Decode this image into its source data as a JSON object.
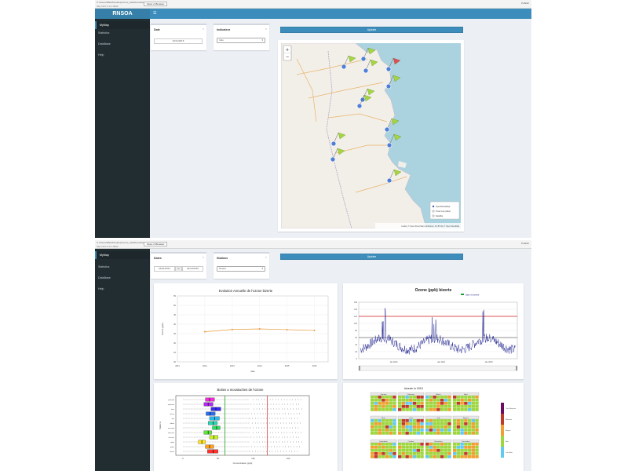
{
  "panel1": {
    "chrome": {
      "url": "C:/Users/WEG/Desktop/ozone_dashboard/app.R",
      "sub": "http://127.0.0.1:4092",
      "open_browser": "Open in Browser",
      "publish": "Publish"
    },
    "app_title": "RNSOA",
    "sidebar": [
      "MyMap",
      "Statistics",
      "DataBase",
      "Help"
    ],
    "date_label": "Date",
    "date_value": "22/11/2015",
    "indicator_label": "Indicateur",
    "indicator_value": "Indo",
    "update_label": "Update",
    "map": {
      "zoom_in": "+",
      "zoom_out": "−",
      "layers": [
        "OpenStreetMap",
        "Toner-Lite (b&w)",
        "Satellite"
      ],
      "attribution": "Leaflet | © Open Street Map contributors, CC-BY-SA, © Open StreetMap",
      "colors": {
        "sea": "#aad3df",
        "land": "#f2efe9",
        "flag_green": "#a5d63f",
        "flag_red": "#e34a5a",
        "marker": "#4f7fd6"
      }
    }
  },
  "panel2": {
    "chrome": {
      "url": "C:/Users/WEG/Desktop/ozone_dashboard/app.R",
      "sub": "http://127.0.0.1:4092",
      "open_browser": "Open in Browser",
      "publish": "Publish"
    },
    "sidebar": [
      "MyMap",
      "Statistics",
      "DataBase",
      "Help"
    ],
    "date_label": "Dates",
    "date_from": "01/01/2011",
    "date_to_sep": "to",
    "date_to": "31/12/2015",
    "station_label": "Stations",
    "station_value": "bizerte",
    "update_label": "Update"
  },
  "chart_data": [
    {
      "type": "line",
      "title": "Evolution Annuelle de l'ozone bizerte",
      "xlabel": "date",
      "ylabel": "Ozone (ppb)",
      "x": [
        2012,
        2013,
        2014,
        2015,
        2016
      ],
      "values": [
        36,
        37.2,
        37.5,
        37.1,
        36.7
      ],
      "x_ticks": [
        "2011",
        "2012",
        "2013",
        "2014",
        "2015",
        "2016"
      ],
      "y_ticks": [
        "20",
        "25",
        "30",
        "35",
        "40",
        "45",
        "50",
        "55"
      ],
      "ylim": [
        20,
        55
      ],
      "color": "#e69c40"
    },
    {
      "type": "line",
      "title": "Ozone (ppb) bizerte",
      "legend": "Date vs bizerte",
      "threshold": 120,
      "mean_line": 60,
      "ylim": [
        0,
        160
      ],
      "y_ticks": [
        "0",
        "20",
        "40",
        "60",
        "80",
        "100",
        "120",
        "140",
        "160"
      ],
      "x_ticks": [
        "Jan 2013",
        "Jan 2014",
        "Jan 2015"
      ],
      "colors": {
        "series": "#1d1f8c",
        "threshold": "#d62020",
        "mean": "#333333"
      }
    },
    {
      "type": "box",
      "title": "Boites a moustaches de l'ozone",
      "xlabel": "Concentration (ppb)",
      "ylabel": "Stations",
      "x_ticks": [
        "0",
        "50",
        "100",
        "150"
      ],
      "xlim": [
        -10,
        180
      ],
      "green_line": 60,
      "red_line": 120,
      "stations": [
        "bizerte",
        "gabes",
        "gafsa",
        "kairouan",
        "kasserine",
        "manouba",
        "nabeul",
        "sfax",
        "sousse",
        "tunis",
        "zaghouan",
        "jendouba"
      ],
      "boxes": [
        {
          "q1": 35,
          "median": 43,
          "q3": 50,
          "color": "#ff3030"
        },
        {
          "q1": 32,
          "median": 38,
          "q3": 44,
          "color": "#ff9f1a"
        },
        {
          "q1": 22,
          "median": 27,
          "q3": 32,
          "color": "#ffe21a"
        },
        {
          "q1": 38,
          "median": 44,
          "q3": 50,
          "color": "#c7ee2a"
        },
        {
          "q1": 30,
          "median": 36,
          "q3": 41,
          "color": "#5fe33a"
        },
        {
          "q1": 42,
          "median": 48,
          "q3": 53,
          "color": "#2bdc5f"
        },
        {
          "q1": 36,
          "median": 43,
          "q3": 49,
          "color": "#2ad6b1"
        },
        {
          "q1": 38,
          "median": 45,
          "q3": 52,
          "color": "#2ab8ea"
        },
        {
          "q1": 33,
          "median": 39,
          "q3": 46,
          "color": "#2a6cf0"
        },
        {
          "q1": 40,
          "median": 47,
          "q3": 54,
          "color": "#3b2aef"
        },
        {
          "q1": 30,
          "median": 36,
          "q3": 43,
          "color": "#b02af0"
        },
        {
          "q1": 32,
          "median": 38,
          "q3": 45,
          "color": "#f02ad8"
        }
      ]
    },
    {
      "type": "heatmap",
      "title": "bizerte in 2015",
      "months": [
        "January",
        "February",
        "March",
        "April",
        "May",
        "June",
        "July",
        "August",
        "September",
        "October",
        "November",
        "December"
      ],
      "legend_labels": [
        "Tres Mauvais",
        "Mauvais",
        "Moyen",
        "Bon",
        "Tres Bon"
      ],
      "legend_colors": [
        "#6a0d5f",
        "#c03a2b",
        "#f0a030",
        "#9ed63f",
        "#62c9f0"
      ]
    }
  ]
}
